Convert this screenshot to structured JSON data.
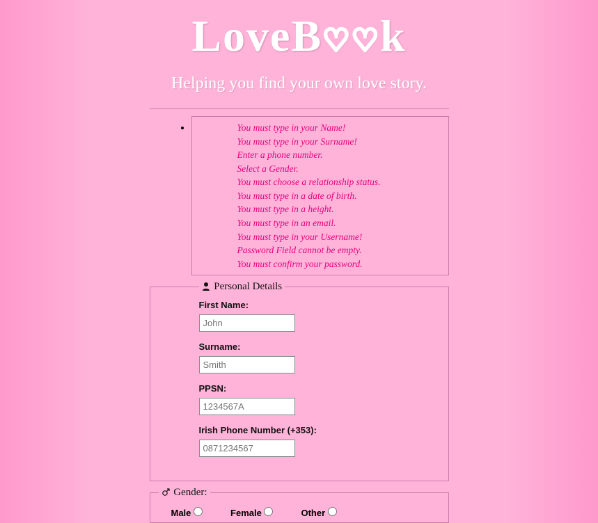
{
  "brand": {
    "name_pre": "LoveB",
    "heart1": "♡",
    "heart2": "♡",
    "name_post": "k",
    "tagline": "Helping you find your own love story."
  },
  "errors": [
    "You must type in your Name!",
    "You must type in your Surname!",
    "Enter a phone number.",
    "Select a Gender.",
    "You must choose a relationship status.",
    "You must type in a date of birth.",
    "You must type in a height.",
    "You must type in an email.",
    "You must type in your Username!",
    "Password Field cannot be empty.",
    "You must confirm your password."
  ],
  "personal": {
    "legend": "Personal Details",
    "first_name": {
      "label": "First Name:",
      "placeholder": "John",
      "value": ""
    },
    "surname": {
      "label": "Surname:",
      "placeholder": "Smith",
      "value": ""
    },
    "ppsn": {
      "label": "PPSN:",
      "placeholder": "1234567A",
      "value": ""
    },
    "phone": {
      "label": "Irish Phone Number (+353):",
      "placeholder": "0871234567",
      "value": ""
    }
  },
  "gender": {
    "legend": "Gender:",
    "options": {
      "male": "Male",
      "female": "Female",
      "other": "Other"
    }
  }
}
